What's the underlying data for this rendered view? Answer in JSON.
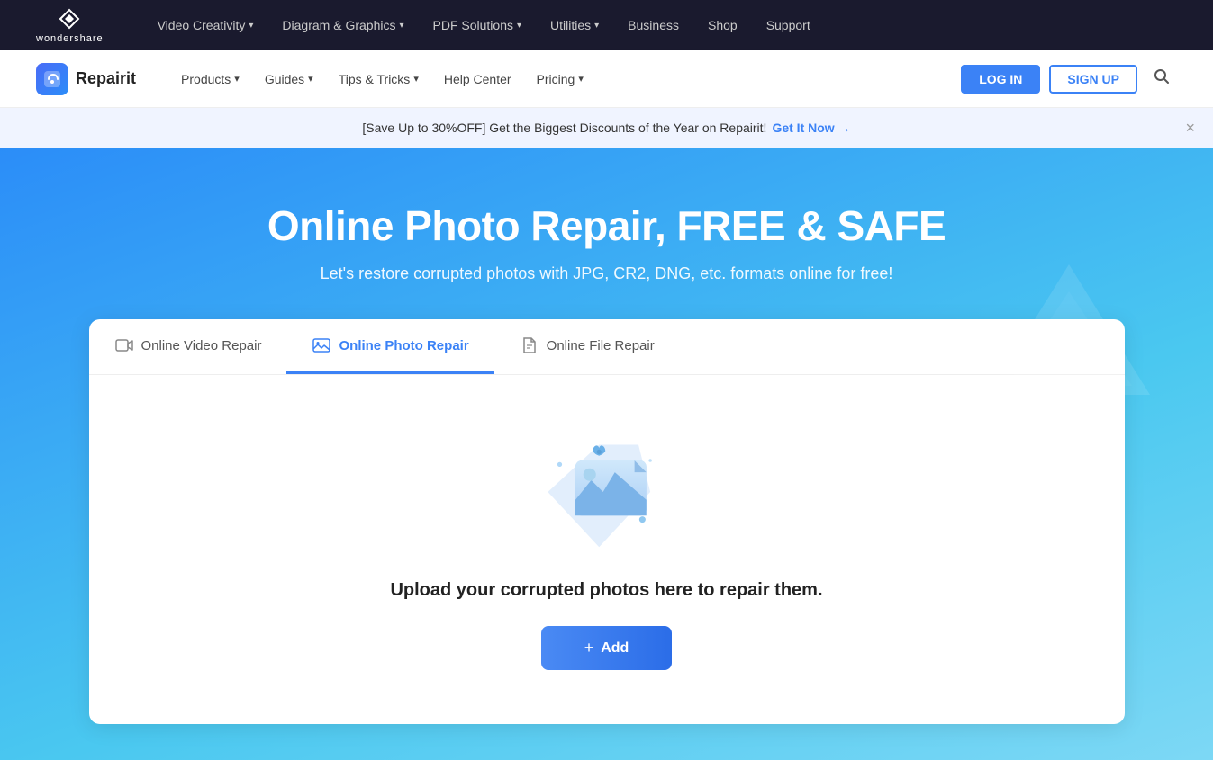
{
  "topNav": {
    "logoText": "wondershare",
    "items": [
      {
        "label": "Video Creativity",
        "hasChevron": true
      },
      {
        "label": "Diagram & Graphics",
        "hasChevron": true
      },
      {
        "label": "PDF Solutions",
        "hasChevron": true
      },
      {
        "label": "Utilities",
        "hasChevron": true
      },
      {
        "label": "Business",
        "hasChevron": false
      },
      {
        "label": "Shop",
        "hasChevron": false
      },
      {
        "label": "Support",
        "hasChevron": false
      }
    ]
  },
  "secondNav": {
    "brandName": "Repairit",
    "items": [
      {
        "label": "Products",
        "hasChevron": true
      },
      {
        "label": "Guides",
        "hasChevron": true
      },
      {
        "label": "Tips & Tricks",
        "hasChevron": true
      },
      {
        "label": "Help Center",
        "hasChevron": false
      },
      {
        "label": "Pricing",
        "hasChevron": true
      }
    ],
    "loginLabel": "LOG IN",
    "signupLabel": "SIGN UP"
  },
  "banner": {
    "text": "[Save Up to 30%OFF] Get the Biggest Discounts of the Year on Repairit!",
    "ctaLabel": "Get It Now →"
  },
  "hero": {
    "title": "Online Photo Repair, FREE & SAFE",
    "subtitle": "Let's restore corrupted photos with JPG, CR2, DNG, etc. formats online for free!"
  },
  "tabs": [
    {
      "id": "video",
      "label": "Online Video Repair",
      "active": false
    },
    {
      "id": "photo",
      "label": "Online Photo Repair",
      "active": true
    },
    {
      "id": "file",
      "label": "Online File Repair",
      "active": false
    }
  ],
  "uploadArea": {
    "text": "Upload your corrupted photos here to repair them.",
    "addLabel": "Add"
  }
}
